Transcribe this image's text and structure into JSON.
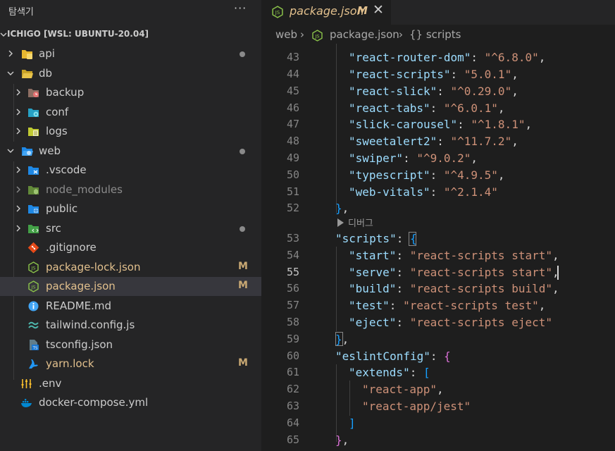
{
  "sidebar": {
    "title": "탐색기",
    "more": "···",
    "workspace": "ICHIGO [WSL: UBUNTU-20.04]",
    "tree": [
      {
        "label": "api",
        "kind": "folder",
        "status": "dot"
      },
      {
        "label": "db",
        "kind": "folder-open",
        "status": ""
      },
      {
        "label": "backup",
        "kind": "folder",
        "status": ""
      },
      {
        "label": "conf",
        "kind": "folder",
        "status": ""
      },
      {
        "label": "logs",
        "kind": "folder",
        "status": ""
      },
      {
        "label": "web",
        "kind": "folder-open",
        "status": "dot"
      },
      {
        "label": ".vscode",
        "kind": "folder",
        "status": ""
      },
      {
        "label": "node_modules",
        "kind": "folder",
        "status": ""
      },
      {
        "label": "public",
        "kind": "folder",
        "status": ""
      },
      {
        "label": "src",
        "kind": "folder",
        "status": "dot"
      },
      {
        "label": ".gitignore",
        "kind": "file",
        "status": ""
      },
      {
        "label": "package-lock.json",
        "kind": "file",
        "status": "M"
      },
      {
        "label": "package.json",
        "kind": "file",
        "status": "M"
      },
      {
        "label": "README.md",
        "kind": "file",
        "status": ""
      },
      {
        "label": "tailwind.config.js",
        "kind": "file",
        "status": ""
      },
      {
        "label": "tsconfig.json",
        "kind": "file",
        "status": ""
      },
      {
        "label": "yarn.lock",
        "kind": "file",
        "status": "M"
      },
      {
        "label": ".env",
        "kind": "file",
        "status": ""
      },
      {
        "label": "docker-compose.yml",
        "kind": "file",
        "status": ""
      }
    ]
  },
  "tab": {
    "name": "package.json",
    "badge": "M",
    "close": "✕"
  },
  "breadcrumb": {
    "part1": "web",
    "part2": "package.json",
    "part3": "{} scripts"
  },
  "codelens": "디버그",
  "line_numbers": [
    "43",
    "44",
    "45",
    "46",
    "47",
    "48",
    "49",
    "50",
    "51",
    "52",
    "53",
    "54",
    "55",
    "56",
    "57",
    "58",
    "59",
    "60",
    "61",
    "62",
    "63",
    "64",
    "65"
  ],
  "code": {
    "l43": {
      "k": "\"react-router-dom\"",
      "s": "\"^6.8.0\""
    },
    "l44": {
      "k": "\"react-scripts\"",
      "s": "\"5.0.1\""
    },
    "l45": {
      "k": "\"react-slick\"",
      "s": "\"^0.29.0\""
    },
    "l46": {
      "k": "\"react-tabs\"",
      "s": "\"^6.0.1\""
    },
    "l47": {
      "k": "\"slick-carousel\"",
      "s": "\"^1.8.1\""
    },
    "l48": {
      "k": "\"sweetalert2\"",
      "s": "\"^11.7.2\""
    },
    "l49": {
      "k": "\"swiper\"",
      "s": "\"^9.0.2\""
    },
    "l50": {
      "k": "\"typescript\"",
      "s": "\"^4.9.5\""
    },
    "l51": {
      "k": "\"web-vitals\"",
      "s": "\"^2.1.4\""
    },
    "l53": {
      "k": "\"scripts\""
    },
    "l54": {
      "k": "\"start\"",
      "s": "\"react-scripts start\""
    },
    "l55": {
      "k": "\"serve\"",
      "s": "\"react-scripts start\""
    },
    "l56": {
      "k": "\"build\"",
      "s": "\"react-scripts build\""
    },
    "l57": {
      "k": "\"test\"",
      "s": "\"react-scripts test\""
    },
    "l58": {
      "k": "\"eject\"",
      "s": "\"react-scripts eject\""
    },
    "l60": {
      "k": "\"eslintConfig\""
    },
    "l61": {
      "k": "\"extends\""
    },
    "l62": {
      "s": "\"react-app\""
    },
    "l63": {
      "s": "\"react-app/jest\""
    }
  },
  "punct": {
    "colon": ": ",
    "comma": ",",
    "obrace": "{",
    "cbrace": "}",
    "obrack": "[",
    "cbrack": "]"
  },
  "colors": {
    "git_modified": "#e2c08d",
    "string": "#ce9178",
    "key": "#9cdcfe",
    "bracket_1": "#da70d6",
    "bracket_2": "#179fff"
  }
}
